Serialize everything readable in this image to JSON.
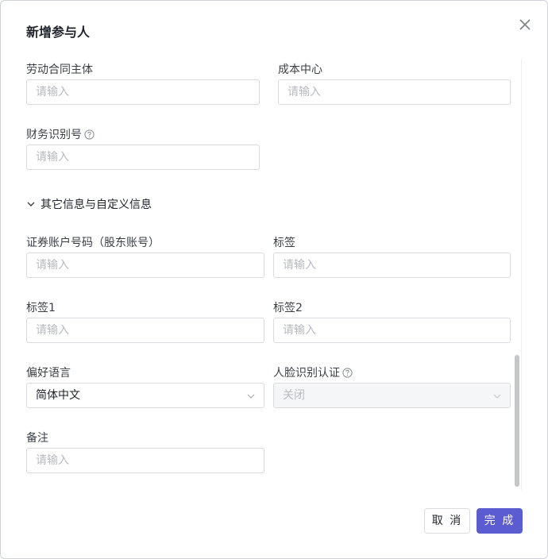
{
  "dialog": {
    "title": "新增参与人",
    "close_icon": "close-icon"
  },
  "fields": {
    "labor_contract_entity": {
      "label": "劳动合同主体",
      "placeholder": "请输入"
    },
    "cost_center": {
      "label": "成本中心",
      "placeholder": "请输入"
    },
    "tax_id": {
      "label": "财务识别号",
      "placeholder": "请输入",
      "help_icon": "question-circle-icon"
    },
    "securities_account": {
      "label": "证券账户号码（股东账号）",
      "placeholder": "请输入"
    },
    "tag": {
      "label": "标签",
      "placeholder": "请输入"
    },
    "tag1": {
      "label": "标签1",
      "placeholder": "请输入"
    },
    "tag2": {
      "label": "标签2",
      "placeholder": "请输入"
    },
    "preferred_language": {
      "label": "偏好语言",
      "value": "简体中文"
    },
    "face_recognition": {
      "label": "人脸识别认证",
      "value": "关闭",
      "help_icon": "question-circle-icon",
      "disabled": true
    },
    "remark": {
      "label": "备注",
      "placeholder": "请输入"
    }
  },
  "section": {
    "label": "其它信息与自定义信息",
    "expanded": true,
    "icon": "chevron-down-icon"
  },
  "footer": {
    "cancel_label": "取 消",
    "ok_label": "完 成"
  },
  "colors": {
    "primary": "#5b5ccf",
    "border": "#d9dbdf",
    "placeholder": "#b7bac0"
  }
}
